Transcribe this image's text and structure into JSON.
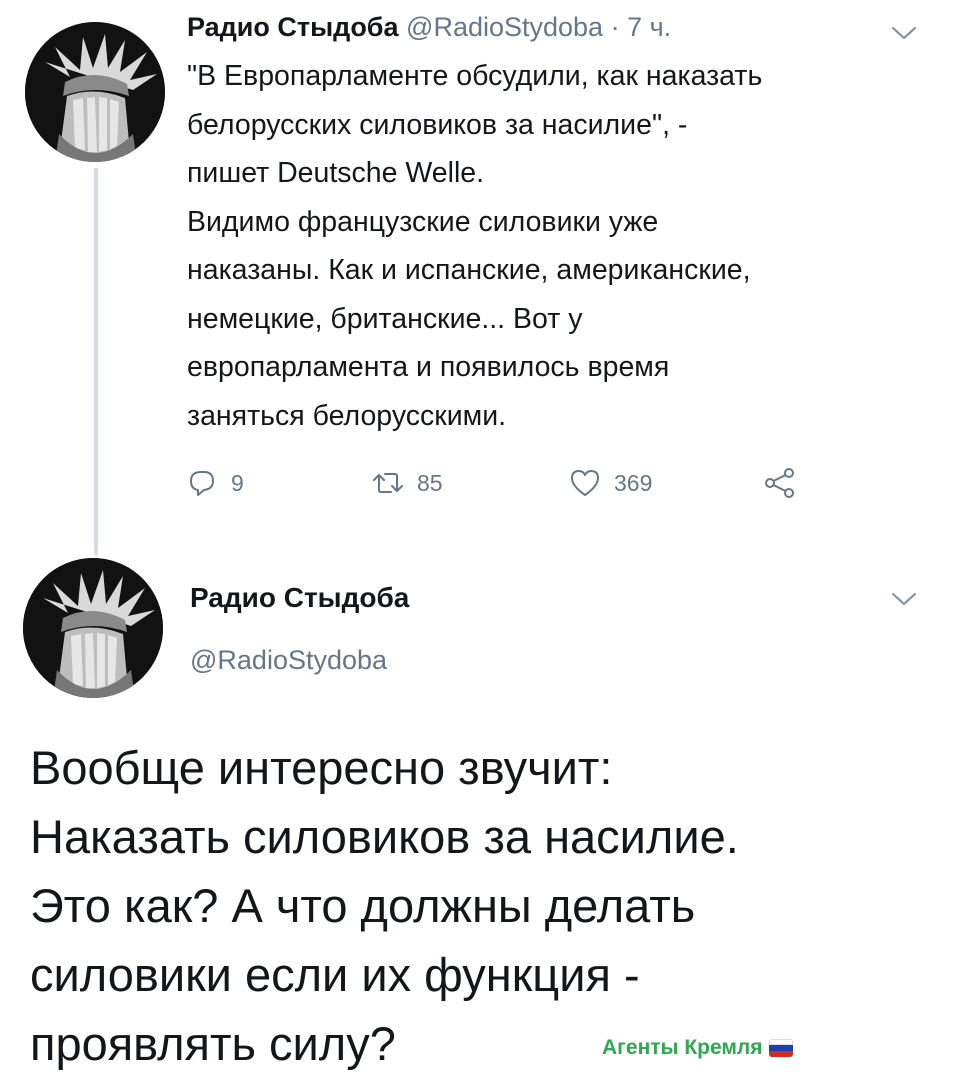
{
  "tweet1": {
    "name": "Радио Стыдоба",
    "handle": "@RadioStydoba",
    "time": "· 7 ч.",
    "lines": [
      "\"В Европарламенте обсудили, как наказать",
      "белорусских силовиков за насилие\", -",
      "пишет Deutsche Welle.",
      "Видимо французские силовики уже",
      "наказаны. Как и испанские, американские,",
      "немецкие, британские... Вот у",
      "европарламента и появилось время",
      "заняться белорусскими."
    ],
    "actions": {
      "replies": "9",
      "retweets": "85",
      "likes": "369"
    }
  },
  "tweet2": {
    "name": "Радио Стыдоба",
    "handle": "@RadioStydoba",
    "lines": [
      "Вообще интересно звучит:",
      "Наказать силовиков за насилие.",
      "Это как? А что должны делать",
      "силовики если их функция -",
      "проявлять силу?"
    ]
  },
  "watermark": "Агенты Кремля",
  "colors": {
    "text": "#14171a",
    "secondary": "#657786",
    "thread_line": "#d6dce1",
    "watermark": "#2fa84f"
  },
  "icons": [
    "avatar-statue",
    "chevron-down-icon",
    "reply-icon",
    "retweet-icon",
    "like-icon",
    "share-icon",
    "russian-flag-icon"
  ]
}
